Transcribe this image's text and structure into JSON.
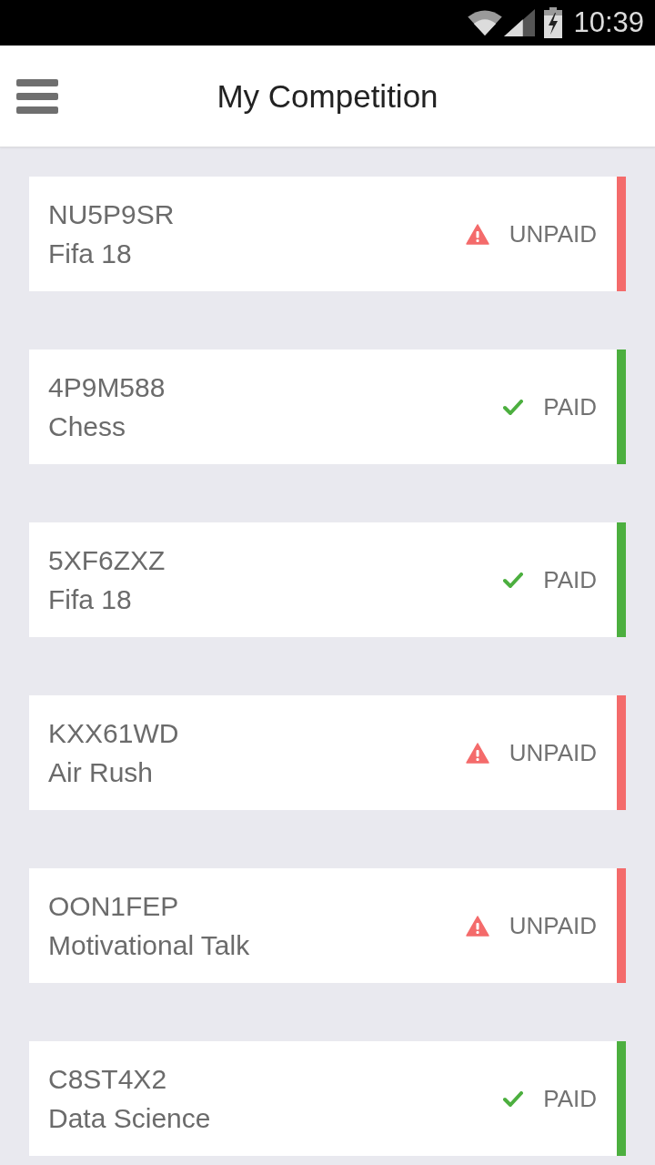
{
  "status_bar": {
    "time": "10:39"
  },
  "app_bar": {
    "title": "My Competition"
  },
  "competitions": [
    {
      "code": "NU5P9SR",
      "name": "Fifa 18",
      "kind": "unpaid",
      "status": "UNPAID"
    },
    {
      "code": "4P9M588",
      "name": "Chess",
      "kind": "paid",
      "status": "PAID"
    },
    {
      "code": "5XF6ZXZ",
      "name": "Fifa 18",
      "kind": "paid",
      "status": "PAID"
    },
    {
      "code": "KXX61WD",
      "name": "Air Rush",
      "kind": "unpaid",
      "status": "UNPAID"
    },
    {
      "code": "OON1FEP",
      "name": "Motivational Talk",
      "kind": "unpaid",
      "status": "UNPAID"
    },
    {
      "code": "C8ST4X2",
      "name": "Data Science",
      "kind": "paid",
      "status": "PAID"
    }
  ]
}
